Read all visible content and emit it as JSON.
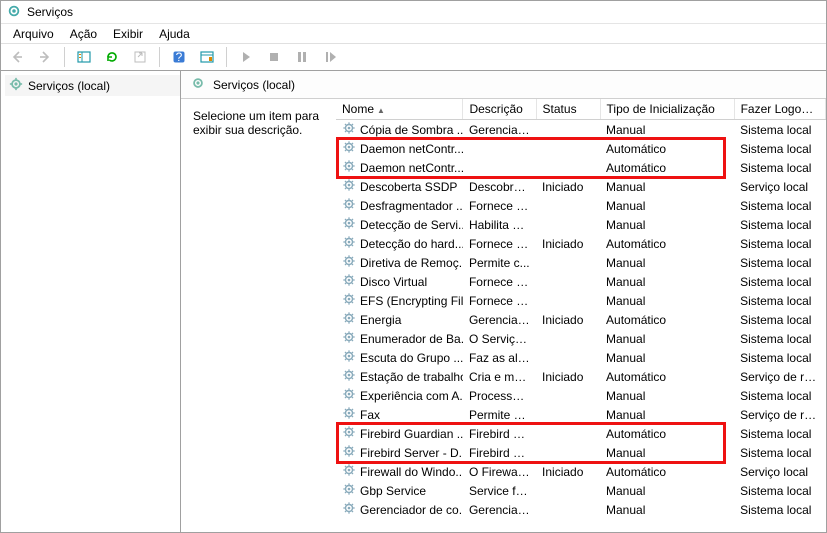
{
  "window": {
    "title": "Serviços"
  },
  "menubar": [
    "Arquivo",
    "Ação",
    "Exibir",
    "Ajuda"
  ],
  "tree": {
    "root": "Serviços (local)"
  },
  "panel": {
    "heading": "Serviços (local)",
    "hint": "Selecione um item para exibir sua descrição."
  },
  "columns": {
    "name": "Nome",
    "desc": "Descrição",
    "status": "Status",
    "startup": "Tipo de Inicialização",
    "logon": "Fazer Logon co"
  },
  "services": [
    {
      "name": "Cópia de Sombra ...",
      "desc": "Gerencia e...",
      "status": "",
      "startup": "Manual",
      "logon": "Sistema local"
    },
    {
      "name": "Daemon netContr...",
      "desc": "",
      "status": "",
      "startup": "Automático",
      "logon": "Sistema local"
    },
    {
      "name": "Daemon netContr...",
      "desc": "",
      "status": "",
      "startup": "Automático",
      "logon": "Sistema local"
    },
    {
      "name": "Descoberta SSDP",
      "desc": "Descobre ...",
      "status": "Iniciado",
      "startup": "Manual",
      "logon": "Serviço local"
    },
    {
      "name": "Desfragmentador ...",
      "desc": "Fornece R...",
      "status": "",
      "startup": "Manual",
      "logon": "Sistema local"
    },
    {
      "name": "Detecção de Servi...",
      "desc": "Habilita a ...",
      "status": "",
      "startup": "Manual",
      "logon": "Sistema local"
    },
    {
      "name": "Detecção do hard...",
      "desc": "Fornece n...",
      "status": "Iniciado",
      "startup": "Automático",
      "logon": "Sistema local"
    },
    {
      "name": "Diretiva de Remoç...",
      "desc": "Permite c...",
      "status": "",
      "startup": "Manual",
      "logon": "Sistema local"
    },
    {
      "name": "Disco Virtual",
      "desc": "Fornece s...",
      "status": "",
      "startup": "Manual",
      "logon": "Sistema local"
    },
    {
      "name": "EFS (Encrypting Fil...",
      "desc": "Fornece a...",
      "status": "",
      "startup": "Manual",
      "logon": "Sistema local"
    },
    {
      "name": "Energia",
      "desc": "Gerencia a...",
      "status": "Iniciado",
      "startup": "Automático",
      "logon": "Sistema local"
    },
    {
      "name": "Enumerador de Ba...",
      "desc": "O Serviço ...",
      "status": "",
      "startup": "Manual",
      "logon": "Sistema local"
    },
    {
      "name": "Escuta do Grupo ...",
      "desc": "Faz as alte...",
      "status": "",
      "startup": "Manual",
      "logon": "Sistema local"
    },
    {
      "name": "Estação de trabalho",
      "desc": "Cria e ma...",
      "status": "Iniciado",
      "startup": "Automático",
      "logon": "Serviço de rede"
    },
    {
      "name": "Experiência com A...",
      "desc": "Processa s...",
      "status": "",
      "startup": "Manual",
      "logon": "Sistema local"
    },
    {
      "name": "Fax",
      "desc": "Permite e...",
      "status": "",
      "startup": "Manual",
      "logon": "Serviço de rede"
    },
    {
      "name": "Firebird Guardian ...",
      "desc": "Firebird Se...",
      "status": "",
      "startup": "Automático",
      "logon": "Sistema local"
    },
    {
      "name": "Firebird Server - D...",
      "desc": "Firebird D...",
      "status": "",
      "startup": "Manual",
      "logon": "Sistema local"
    },
    {
      "name": "Firewall do Windo...",
      "desc": "O Firewall ...",
      "status": "Iniciado",
      "startup": "Automático",
      "logon": "Serviço local"
    },
    {
      "name": "Gbp Service",
      "desc": "Service for...",
      "status": "",
      "startup": "Manual",
      "logon": "Sistema local"
    },
    {
      "name": "Gerenciador de co...",
      "desc": "Gerencia c...",
      "status": "",
      "startup": "Manual",
      "logon": "Sistema local"
    }
  ]
}
